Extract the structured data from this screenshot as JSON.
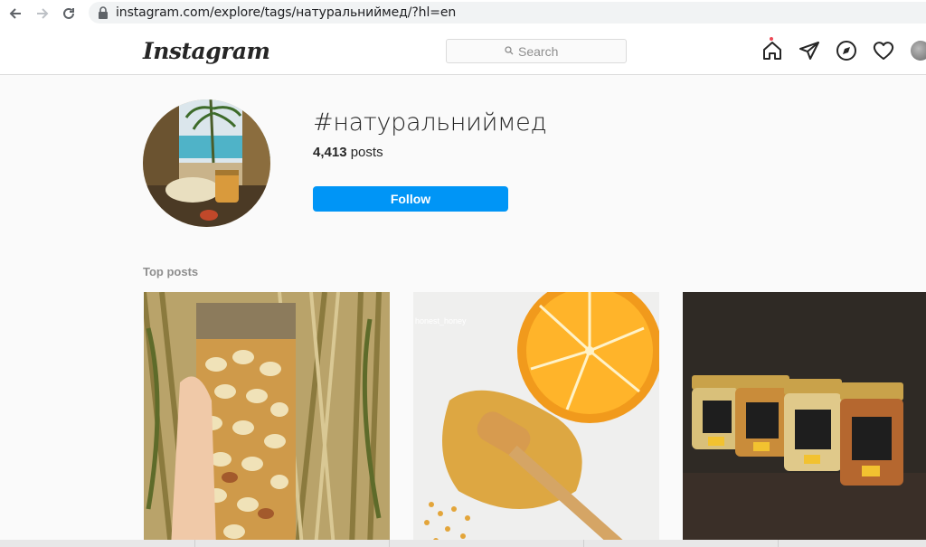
{
  "browser": {
    "url": "instagram.com/explore/tags/натуральниймед/?hl=en",
    "icons": [
      "back-arrow-icon",
      "forward-arrow-icon",
      "reload-icon",
      "lock-icon"
    ]
  },
  "header": {
    "logo": "Instagram",
    "search_placeholder": "Search",
    "icons": [
      "home-icon",
      "direct-icon",
      "explore-icon",
      "heart-icon",
      "avatar"
    ]
  },
  "tag": {
    "name": "#натуральниймед",
    "posts_number": "4,413",
    "posts_label": "posts",
    "follow_label": "Follow"
  },
  "top_posts": {
    "title": "Top posts",
    "posts": [
      {
        "subject": "jar of nuts in honey"
      },
      {
        "subject": "orange and honey dipper",
        "watermark": "honest_honey"
      },
      {
        "subject": "honey jars with nuts"
      }
    ]
  },
  "colors": {
    "accent": "#0095f6",
    "notification": "#ed4956",
    "text": "#262626",
    "muted": "#8e8e8e"
  }
}
